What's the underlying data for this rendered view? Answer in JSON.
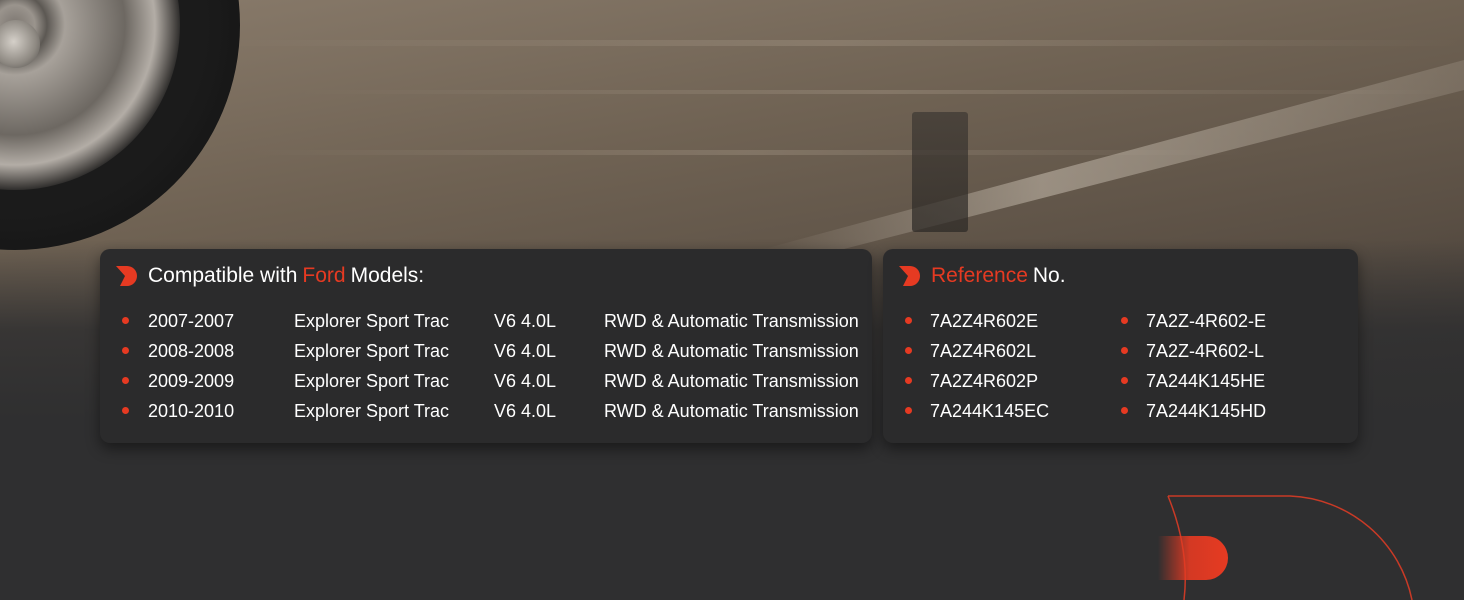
{
  "compat_panel": {
    "title_prefix": "Compatible with ",
    "title_brand": "Ford",
    "title_suffix": " Models:",
    "rows": [
      {
        "year": "2007-2007",
        "model": "Explorer Sport Trac",
        "engine": "V6 4.0L",
        "drive": "RWD & Automatic Transmission"
      },
      {
        "year": "2008-2008",
        "model": "Explorer Sport Trac",
        "engine": "V6 4.0L",
        "drive": "RWD & Automatic Transmission"
      },
      {
        "year": "2009-2009",
        "model": "Explorer Sport Trac",
        "engine": "V6 4.0L",
        "drive": "RWD & Automatic Transmission"
      },
      {
        "year": "2010-2010",
        "model": "Explorer Sport Trac",
        "engine": "V6 4.0L",
        "drive": "RWD & Automatic Transmission"
      }
    ]
  },
  "reference_panel": {
    "title_accent": "Reference",
    "title_suffix": " No.",
    "left_numbers": [
      "7A2Z4R602E",
      "7A2Z4R602L",
      "7A2Z4R602P",
      "7A244K145EC"
    ],
    "right_numbers": [
      "7A2Z-4R602-E",
      "7A2Z-4R602-L",
      "7A244K145HE",
      "7A244K145HD"
    ]
  },
  "colors": {
    "accent": "#e63a22",
    "panel": "#2b2b2c",
    "background": "#2f2f30",
    "text": "#ffffff"
  },
  "icons": {
    "title_mark": "brand-d-icon",
    "decoration": "brand-d-icon"
  }
}
